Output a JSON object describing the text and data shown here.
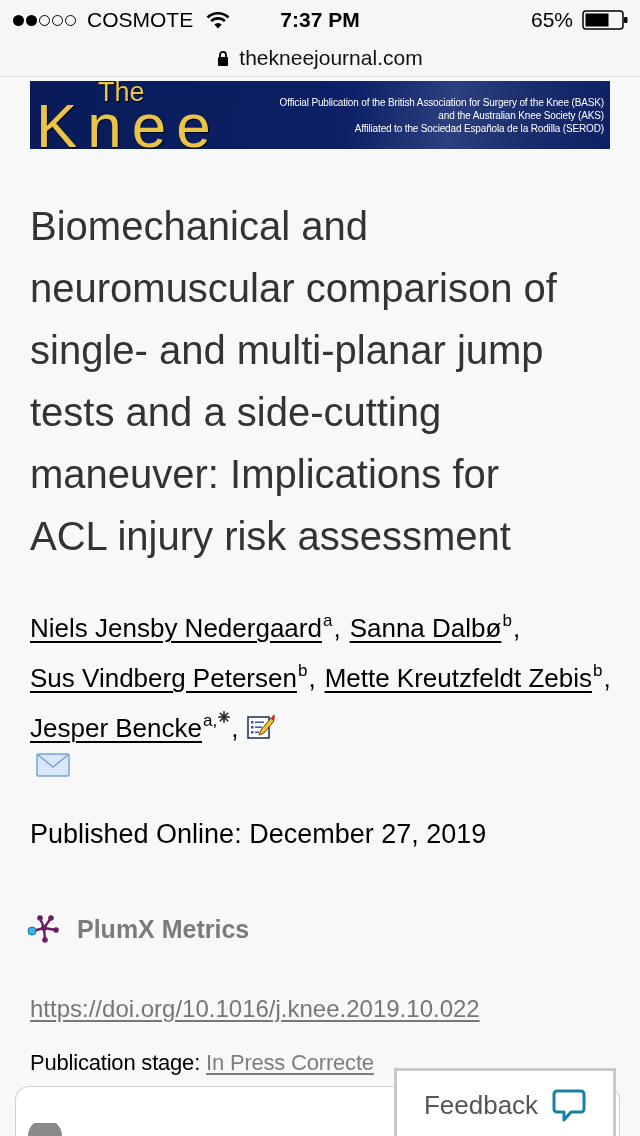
{
  "status_bar": {
    "carrier": "COSMOTE",
    "time": "7:37 PM",
    "battery": "65%"
  },
  "address_bar": {
    "url": "thekneejournal.com"
  },
  "banner": {
    "logo_small": "The",
    "logo_large": "Knee",
    "lines": [
      "Official Publication of the British Association for Surgery of the Knee (BASK)",
      "and the Australian Knee Society (AKS)",
      "Affiliated to the Sociedad Española de la Rodilla (SEROD)"
    ]
  },
  "article": {
    "title": "Biomechanical and neuromuscular comparison of single- and multi-planar jump tests and a side-cutting maneuver: Implications for ACL injury risk assessment",
    "authors": [
      {
        "name": "Niels Jensby Nedergaard",
        "affiliation": "a",
        "corresponding": false,
        "separator": ","
      },
      {
        "name": "Sanna Dalbø",
        "affiliation": "b",
        "corresponding": false,
        "separator": ","
      },
      {
        "name": "Sus Vindberg Petersen",
        "affiliation": "b",
        "corresponding": false,
        "separator": ","
      },
      {
        "name": "Mette Kreutzfeldt Zebis",
        "affiliation": "b",
        "corresponding": false,
        "separator": ","
      },
      {
        "name": "Jesper Bencke",
        "affiliation": "a,",
        "corresponding": true,
        "separator": ","
      }
    ],
    "published": "Published Online: December 27, 2019",
    "metrics_link": "PlumX Metrics",
    "doi": "https://doi.org/10.1016/j.knee.2019.10.022",
    "stage_label": "Publication stage:",
    "stage_value": "In Press Correcte"
  },
  "feedback": {
    "label": "Feedback"
  }
}
